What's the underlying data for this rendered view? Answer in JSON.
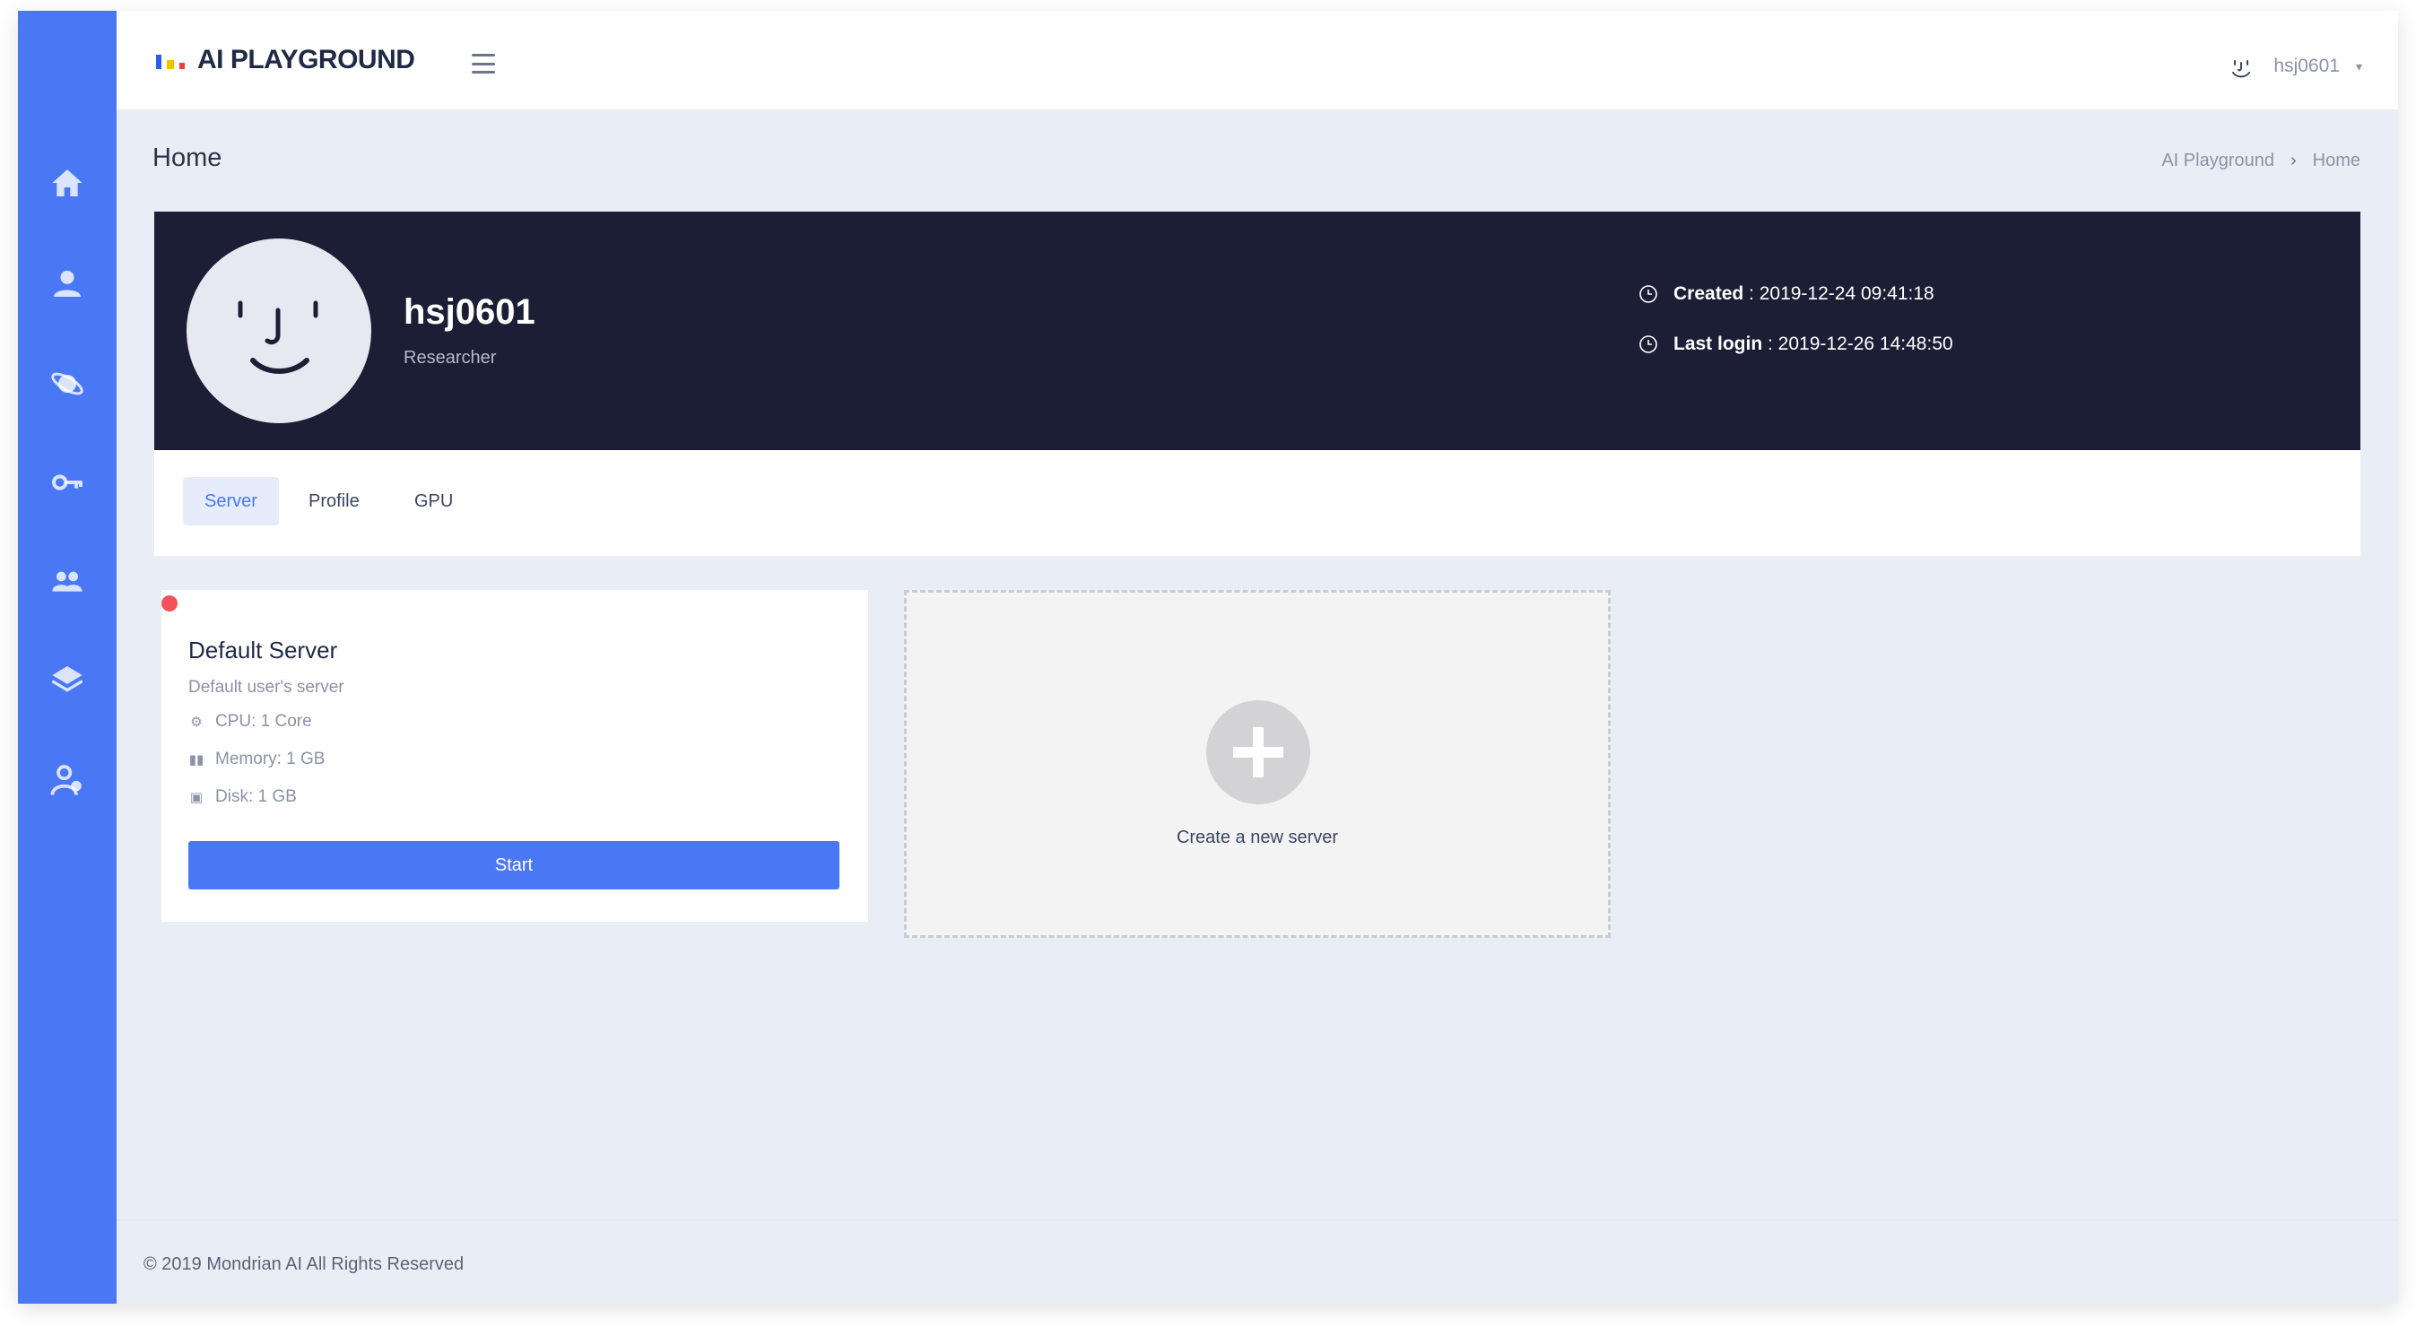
{
  "app": {
    "logo_text": "AI PLAYGROUND",
    "brand_color": "#4a78f5",
    "logo_colors": [
      "#2f5be7",
      "#f2c200",
      "#ef3e36"
    ]
  },
  "sidebar": {
    "items": [
      {
        "icon": "home-icon"
      },
      {
        "icon": "user-icon"
      },
      {
        "icon": "planet-icon"
      },
      {
        "icon": "key-icon"
      },
      {
        "icon": "group-icon"
      },
      {
        "icon": "layers-icon"
      },
      {
        "icon": "team-admin-icon"
      }
    ]
  },
  "header": {
    "username": "hsj0601",
    "caret": "▾"
  },
  "page": {
    "title": "Home",
    "breadcrumb": [
      "AI Playground",
      "Home"
    ],
    "breadcrumb_sep": "›"
  },
  "profile": {
    "username": "hsj0601",
    "role": "Researcher",
    "created_label": "Created",
    "created_value": " : 2019-12-24 09:41:18",
    "last_login_label": "Last login",
    "last_login_value": " : 2019-12-26 14:48:50"
  },
  "tabs": [
    {
      "label": "Server",
      "active": true
    },
    {
      "label": "Profile",
      "active": false
    },
    {
      "label": "GPU",
      "active": false
    }
  ],
  "server": {
    "status_color": "#f2525a",
    "title": "Default Server",
    "description": "Default user's server",
    "cpu": "CPU: 1 Core",
    "memory": "Memory: 1 GB",
    "disk": "Disk: 1 GB",
    "start_label": "Start"
  },
  "new_server": {
    "label": "Create a new server"
  },
  "footer": {
    "text": "© 2019 Mondrian AI All Rights Reserved"
  }
}
